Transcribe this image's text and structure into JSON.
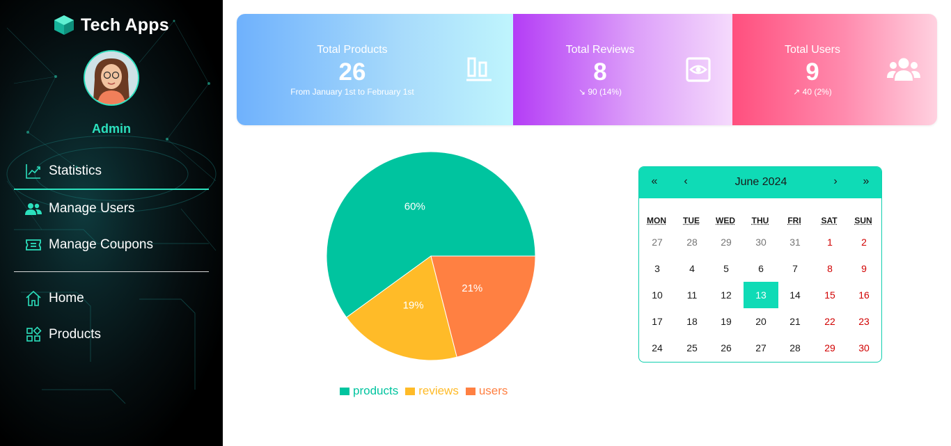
{
  "sidebar": {
    "brand": "Tech Apps",
    "role": "Admin",
    "nav": [
      {
        "label": "Statistics",
        "icon": "chart-line-icon",
        "active": true
      },
      {
        "label": "Manage Users",
        "icon": "users-icon"
      },
      {
        "label": "Manage Coupons",
        "icon": "ticket-icon"
      },
      {
        "label": "Home",
        "icon": "home-icon"
      },
      {
        "label": "Products",
        "icon": "grid-icon"
      }
    ]
  },
  "stats": {
    "products": {
      "title": "Total Products",
      "value": "26",
      "sub": "From January 1st to February 1st",
      "icon": "bar-align-icon"
    },
    "reviews": {
      "title": "Total Reviews",
      "value": "8",
      "sub": "↘ 90 (14%)",
      "icon": "eye-icon"
    },
    "users": {
      "title": "Total Users",
      "value": "9",
      "sub": "↗ 40 (2%)",
      "icon": "users-icon"
    }
  },
  "chart_data": {
    "type": "pie",
    "categories": [
      "products",
      "reviews",
      "users"
    ],
    "values": [
      60,
      19,
      21
    ],
    "labels": [
      "60%",
      "19%",
      "21%"
    ],
    "colors": [
      "#00c49f",
      "#ffbb28",
      "#ff8042"
    ],
    "legend_position": "bottom"
  },
  "calendar": {
    "title": "June 2024",
    "nav": {
      "prev_year": "«",
      "prev_month": "‹",
      "next_month": "›",
      "next_year": "»"
    },
    "weekdays": [
      "MON",
      "TUE",
      "WED",
      "THU",
      "FRI",
      "SAT",
      "SUN"
    ],
    "weeks": [
      [
        "27",
        "28",
        "29",
        "30",
        "31",
        "1",
        "2"
      ],
      [
        "3",
        "4",
        "5",
        "6",
        "7",
        "8",
        "9"
      ],
      [
        "10",
        "11",
        "12",
        "13",
        "14",
        "15",
        "16"
      ],
      [
        "17",
        "18",
        "19",
        "20",
        "21",
        "22",
        "23"
      ],
      [
        "24",
        "25",
        "26",
        "27",
        "28",
        "29",
        "30"
      ]
    ],
    "today": "13"
  },
  "colors": {
    "accent": "#2ce0bd",
    "calendar_header": "#0fdbb6",
    "weekend": "#d10000"
  }
}
